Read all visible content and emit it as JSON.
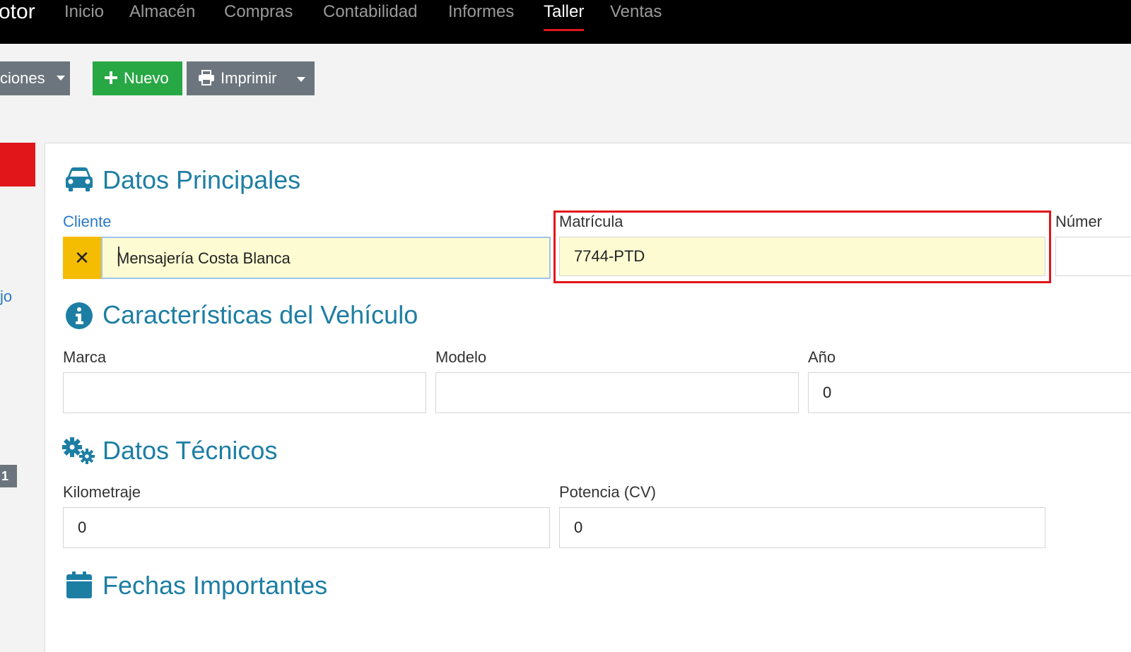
{
  "navbar": {
    "brand": "otor",
    "items": [
      {
        "id": "inicio",
        "label": "Inicio",
        "active": false
      },
      {
        "id": "almacen",
        "label": "Almacén",
        "active": false
      },
      {
        "id": "compras",
        "label": "Compras",
        "active": false
      },
      {
        "id": "contabilidad",
        "label": "Contabilidad",
        "active": false
      },
      {
        "id": "informes",
        "label": "Informes",
        "active": false
      },
      {
        "id": "taller",
        "label": "Taller",
        "active": true
      },
      {
        "id": "ventas",
        "label": "Ventas",
        "active": false
      }
    ],
    "active_color": "#e0161b"
  },
  "toolbar": {
    "options_label": "ciones",
    "new_label": "Nuevo",
    "print_label": "Imprimir"
  },
  "sidebar": {
    "link_text": "jo",
    "badge": "1"
  },
  "sections": {
    "principal": {
      "title": "Datos Principales",
      "icon": "car-icon",
      "cliente_label": "Cliente",
      "cliente_value": "Mensajería Costa Blanca",
      "matricula_label": "Matrícula",
      "matricula_value": "7744-PTD",
      "numero_label": "Númer"
    },
    "caracteristicas": {
      "title": "Características del Vehículo",
      "icon": "info-icon",
      "marca_label": "Marca",
      "marca_value": "",
      "modelo_label": "Modelo",
      "modelo_value": "",
      "anio_label": "Año",
      "anio_value": "0"
    },
    "tecnicos": {
      "title": "Datos Técnicos",
      "icon": "gears-icon",
      "kilometraje_label": "Kilometraje",
      "kilometraje_value": "0",
      "potencia_label": "Potencia (CV)",
      "potencia_value": "0"
    },
    "fechas": {
      "title": "Fechas Importantes",
      "icon": "calendar-icon"
    }
  },
  "colors": {
    "accent_title": "#1d7ea3",
    "green_button": "#28a745",
    "gray_button": "#6c757d",
    "highlight": "#e0161b",
    "clear_button": "#f5bd02"
  }
}
